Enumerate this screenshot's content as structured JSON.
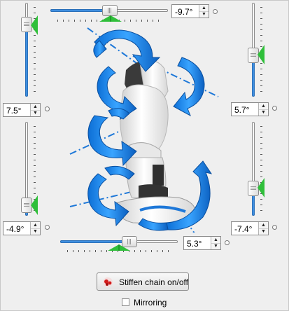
{
  "joints": {
    "top": {
      "value": "-9.7°",
      "level": 0.5
    },
    "left_upper": {
      "value": "7.5°",
      "level": 0.83
    },
    "right_upper": {
      "value": "5.7°",
      "level": 0.5
    },
    "left_lower": {
      "value": "-4.9°",
      "level": 0.23
    },
    "right_lower": {
      "value": "-7.4°",
      "level": 0.28
    },
    "bottom": {
      "value": "5.3°",
      "level": 0.58
    }
  },
  "spin_arrows": {
    "up": "▲",
    "down": "▼"
  },
  "stiffen_button": {
    "label": "Stiffen chain on/off",
    "icon": "stiffness-icon"
  },
  "mirroring": {
    "label": "Mirroring",
    "checked": false
  },
  "colors": {
    "accent_blue": "#1e8ff0",
    "slider_fill": "#3f8fe0",
    "marker_green": "#2fbf3a"
  }
}
